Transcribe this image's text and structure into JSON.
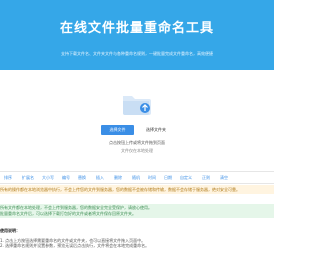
{
  "hero": {
    "title": "在线文件批量重命名工具",
    "subtitle": "支持下载文件名、文件夹文件与各种重命名规则，一键批量完成文件重命名，高效便捷"
  },
  "upload": {
    "btn_file": "选择文件",
    "btn_folder": "选择文件夹",
    "hint_main": "点击按钮上传或将文件拖到页面",
    "hint_sub": "文件仅在本地处理"
  },
  "toolbar": {
    "items": [
      "排序",
      "扩展名",
      "大小写",
      "编号",
      "替换",
      "插入",
      "删除",
      "随机",
      "时间",
      "日期",
      "自定义",
      "正则",
      "清空"
    ]
  },
  "notices": {
    "warning": "所有的操作都在本地浏览器中执行，不会上传您的文件到服务器，您的数据不会被存储和传输，数据不会存储于服务器，绝对安全可靠。",
    "info_line1": "所有文件都在本地处理，不会上传到服务器，您的数据安全完全受保护，请放心使用。",
    "info_line2": "批量重命名文件后，可以选择下载打包好的文件或者将文件保存回原文件夹。"
  },
  "section": {
    "title": "使用说明：",
    "line1": "1. 点击上方按钮选择需要重命名的文件或文件夹，也可以直接将文件拖入页面中。",
    "line2": "2. 选择重命名规则并设置参数，预览无误后点击执行，文件将会在本地完成重命名。"
  }
}
